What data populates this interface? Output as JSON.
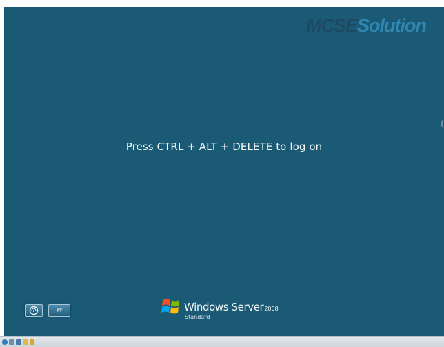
{
  "watermark": {
    "part1": "MCSE",
    "part2": "Solution"
  },
  "logon": {
    "prompt": "Press CTRL + ALT + DELETE to log on"
  },
  "buttons": {
    "ease_of_access_icon": "ease-of-access-icon",
    "language_label": "PT"
  },
  "branding": {
    "product": "Windows Server",
    "version": "2008",
    "edition": "Standard",
    "logo_icon": "windows-flag-icon"
  },
  "taskbar": {
    "icons": [
      "start-icon",
      "server-manager-icon",
      "computer-icon",
      "folder-icon",
      "arrow-icon"
    ]
  },
  "colors": {
    "background": "#1b5a75",
    "text": "#f4f8fa",
    "watermark_dark": "#1d4a62",
    "watermark_light": "#2f87b4"
  }
}
